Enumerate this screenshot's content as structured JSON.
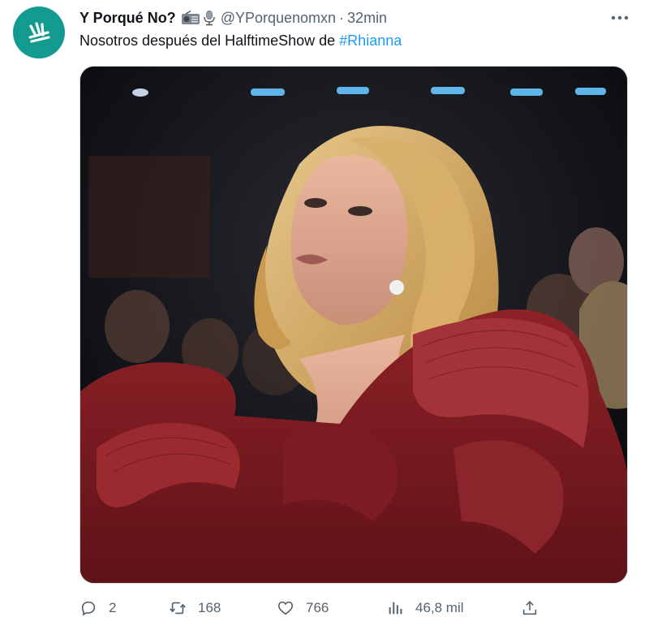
{
  "account": {
    "display_name": "Y Porqué No?",
    "emojis": [
      "radio-icon",
      "microphone-icon"
    ],
    "handle": "@YPorquenomxn",
    "separator": "·",
    "time": "32min",
    "avatar_color": "#149b8f"
  },
  "tweet": {
    "text": "Nosotros después del HalftimeShow de ",
    "hashtag": "#Rhianna",
    "hashtag_color": "#1d9bf0"
  },
  "media": {
    "icon": "photo"
  },
  "actions": {
    "reply": {
      "icon": "reply-icon",
      "count": "2"
    },
    "retweet": {
      "icon": "retweet-icon",
      "count": "168"
    },
    "like": {
      "icon": "heart-icon",
      "count": "766"
    },
    "views": {
      "icon": "views-icon",
      "count": "46,8 mil"
    },
    "share": {
      "icon": "share-icon"
    }
  },
  "colors": {
    "text": "#0f1419",
    "muted": "#536471",
    "gown": "#7a1a1f"
  }
}
